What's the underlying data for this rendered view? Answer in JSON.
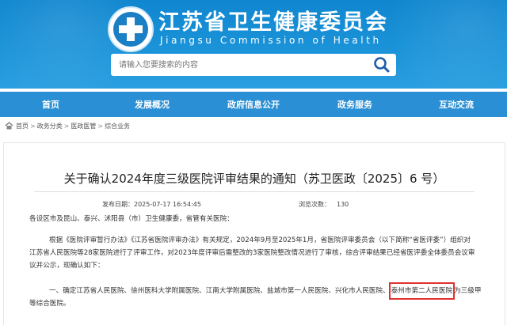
{
  "header": {
    "title": "江苏省卫生健康委员会",
    "subtitle": "Jiangsu Commission of Health",
    "logo_icon": "health-commission-emblem-icon"
  },
  "search": {
    "placeholder": "请输入您要搜索的内容",
    "button_icon": "search-icon"
  },
  "nav": {
    "items": [
      "首页",
      "发展概况",
      "政府信息公开",
      "政务服务",
      "互动交流"
    ]
  },
  "breadcrumb": {
    "icon": "home-icon",
    "items": [
      "首页",
      "政务分类",
      "医政医管",
      "综合业务"
    ],
    "separator": ">"
  },
  "article": {
    "title": "关于确认2024年度三级医院评审结果的通知（苏卫医政〔2025〕6 号）",
    "publish_label": "发布日期：",
    "publish_date": "2025-07-17 16:54:45",
    "views_label": "浏览次数：",
    "views": "130",
    "salutation": "各设区市及昆山、泰兴、沭阳县（市）卫生健康委，省管有关医院：",
    "para1_line1": "根据《医院评审暂行办法》《江苏省医院评审办法》有关规定，2024年9月至2025年1月，省医院评审委员会（以下简称“省医评委”）组织对",
    "para1_line2": "江苏省人民医院等28家医院进行了评审工作，对2023年度评审后需整改的3家医院整改情况进行了审核，综合评审结果已经省医评委全体委员会议审",
    "para1_line3": "议并公示，现确认如下：",
    "para2_prefix": "一、确定江苏省人民医院、徐州医科大学附属医院、江南大学附属医院、盐城市第一人民医院、兴化市人民医院、",
    "para2_highlight": "泰州市第二人民医院",
    "para2_suffix": "为三级甲",
    "para2_line2": "等综合医院。"
  },
  "colors": {
    "header_blue": "#1b93d8",
    "nav_blue": "#2a8fd4",
    "highlight_red": "#e03131"
  }
}
